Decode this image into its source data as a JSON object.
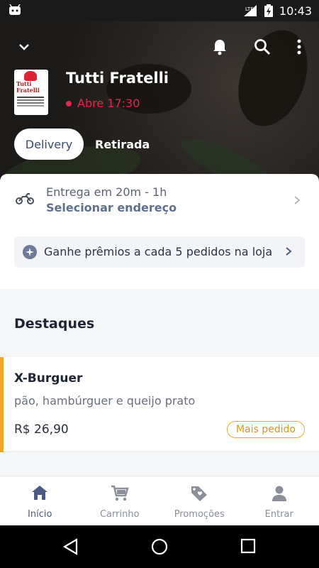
{
  "status_bar": {
    "time": "10:43",
    "network": "LTE"
  },
  "header": {
    "store_name": "Tutti Fratelli",
    "store_status": "Abre 17:30",
    "logo_text": "Tutti\nFratelli",
    "tabs": [
      {
        "label": "Delivery",
        "active": true
      },
      {
        "label": "Retirada",
        "active": false
      }
    ]
  },
  "delivery": {
    "eta": "Entrega em 20m - 1h",
    "select_address": "Selecionar endereço"
  },
  "rewards": {
    "text": "Ganhe prêmios a cada 5 pedidos na loja"
  },
  "highlights": {
    "title": "Destaques",
    "items": [
      {
        "name": "X-Burguer",
        "description": "pão, hambúrguer e queijo prato",
        "price": "R$ 26,90",
        "badge": "Mais pedido"
      }
    ]
  },
  "bottom_nav": [
    {
      "label": "Início",
      "icon": "home-icon",
      "active": true
    },
    {
      "label": "Carrinho",
      "icon": "cart-icon",
      "active": false
    },
    {
      "label": "Promoções",
      "icon": "tag-heart-icon",
      "active": false
    },
    {
      "label": "Entrar",
      "icon": "user-icon",
      "active": false
    }
  ],
  "colors": {
    "accent": "#4a5a82",
    "closed": "#e2264b",
    "highlight": "#f0a62a"
  }
}
